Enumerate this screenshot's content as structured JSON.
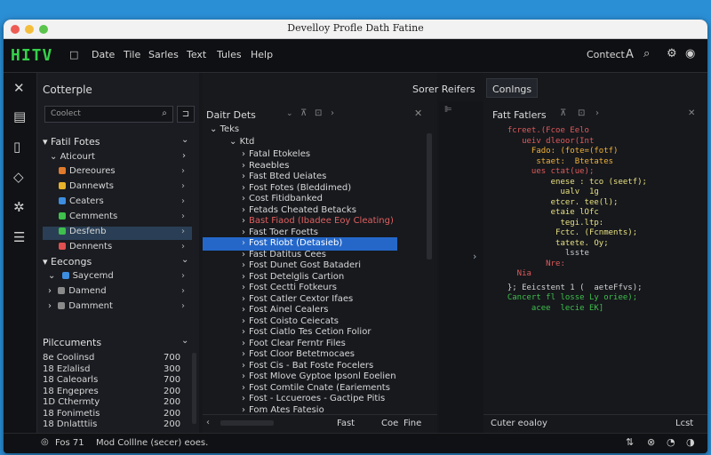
{
  "window": {
    "title": "Develloy Profle Dath Fatine"
  },
  "menubar": {
    "logo": "HITV",
    "items": [
      "Date",
      "Tile",
      "Sarles",
      "Text",
      "Tules",
      "Help"
    ],
    "contact": "Contect"
  },
  "left_panel": {
    "title": "Cotterple",
    "search_placeholder": "Coolect",
    "section1": "Fatil Fotes",
    "group1": "Aticourt",
    "items1": [
      {
        "label": "Dereoures",
        "color": "#e07a2c"
      },
      {
        "label": "Dannewts",
        "color": "#e8b22a"
      },
      {
        "label": "Ceaters",
        "color": "#3d8ee0"
      },
      {
        "label": "Cemments",
        "color": "#3fbf4c"
      },
      {
        "label": "Desfenb",
        "color": "#3fbf4c"
      },
      {
        "label": "Dennents",
        "color": "#e05050"
      }
    ],
    "section2": "Eecongs",
    "items2": [
      "Saycemd",
      "Damend",
      "Damment"
    ],
    "section3": "Pilccuments",
    "data_rows": [
      {
        "label": "8e Coolinsd",
        "value": "700"
      },
      {
        "label": "18 Ezlalisd",
        "value": "300"
      },
      {
        "label": "18 Caleoarls",
        "value": "700"
      },
      {
        "label": "18 Engepres",
        "value": "200"
      },
      {
        "label": "1D Cthermty",
        "value": "200"
      },
      {
        "label": "18 Fonimetis",
        "value": "200"
      },
      {
        "label": "18 Dnlatttiis",
        "value": "200"
      }
    ]
  },
  "middle_panel": {
    "header": "Sorer Reifers",
    "title": "Daitr Dets",
    "root": "Teks",
    "sub": "Ktd",
    "rows": [
      "Fatal Etokeles",
      "Reaebles",
      "Fast Bted Ueiates",
      "Fost Fotes (Bleddimed)",
      "Cost Fitidbanked",
      "Fetads Cheated Betacks",
      "Bast Fiaod (Ibadee Eoy Cleating)",
      "Fast Toer Foetts",
      "Fost Riobt (Detasieb)",
      "Fast Datitus Cees",
      "Fost Dunet Gost Bataderi",
      "Fost Detelglis Cartion",
      "Fost Cectti Fotkeurs",
      "Fost Catler Cextor Ifaes",
      "Fost Ainel Cealers",
      "Fost Coisto Ceiecats",
      "Fost Ciatlo Tes Cetion Folior",
      "Foot Clear Ferntr Files",
      "Fost Cloor Betetmocaes",
      "Fost Cis - Bat Foste Focelers",
      "Fost Mlove Gyptoe Ipsonl Eoelien",
      "Fost Comtile Cnate (Eariements",
      "Fost - Lccueroes - Gactipe Pitis",
      "Fom Ates Fatesio"
    ],
    "footer_left": "Fast",
    "footer_mid": "Coe",
    "footer_right": "Fine"
  },
  "right_panel": {
    "tab": "Conlngs",
    "title": "Fatt Fatlers",
    "footer": "Cuter eoaloy",
    "footer_right": "Lcst"
  },
  "code_lines": [
    {
      "text": "  fcreet.(Fcoe Eelo",
      "color": "#e05a5a"
    },
    {
      "text": "     ueiv dleoor(Int",
      "color": "#e05a5a"
    },
    {
      "text": "       Fado: (fote=(fotf)",
      "color": "#f0b03a"
    },
    {
      "text": "        staet:  Btetates",
      "color": "#f0b03a"
    },
    {
      "text": "       ues ctat(ue);",
      "color": "#e05a5a"
    },
    {
      "text": "           enese : tco (seetf);",
      "color": "#e8e080"
    },
    {
      "text": "             ualv  1g",
      "color": "#e8e080"
    },
    {
      "text": "           etcer. tee(l);",
      "color": "#e8e080"
    },
    {
      "text": "           etaie lOfc",
      "color": "#e8e080"
    },
    {
      "text": "             tegi.ltp:",
      "color": "#e8e080"
    },
    {
      "text": "            Fctc. (Fcnments);",
      "color": "#e8e080"
    },
    {
      "text": "            tatete. Oy;",
      "color": "#e8e080"
    },
    {
      "text": "              lsste",
      "color": "#cccccc"
    },
    {
      "text": "          Nre:",
      "color": "#e05a5a"
    },
    {
      "text": "    Nia",
      "color": "#e05a5a"
    },
    {
      "text": "  }; Eeicstent 1 (  aeteFfvs);",
      "color": "#d0d0d0"
    },
    {
      "text": "  Cancert fl losse Ly oriee);",
      "color": "#3fbf4c"
    },
    {
      "text": "       acee  lecie EK]",
      "color": "#3fbf4c"
    }
  ],
  "status": {
    "left": "Fos 71",
    "text": "Mod Colllne (secer) eoes."
  }
}
